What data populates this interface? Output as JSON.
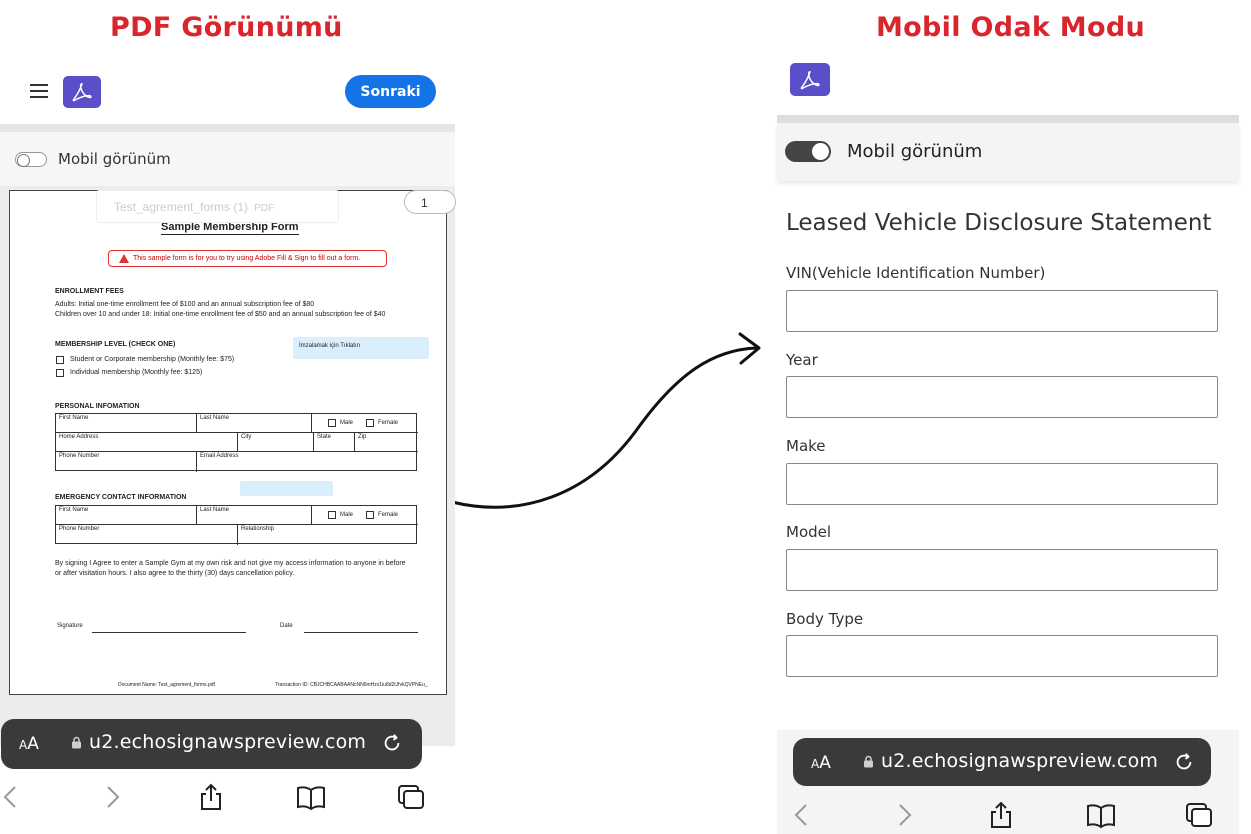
{
  "headings": {
    "left": "PDF Görünümü",
    "right": "Mobil Odak Modu"
  },
  "left_phone": {
    "next_button": "Sonraki",
    "toggle_label": "Mobil görünüm",
    "page_number": "1",
    "doc_name": "Test_agrement_forms (1)",
    "doc_type": "PDF",
    "pdf": {
      "title": "Sample Membership Form",
      "notice": "This sample form is for you to try using Adobe Fill & Sign to fill out a form.",
      "enrollment_title": "ENROLLMENT FEES",
      "enrollment_line1": "Adults: Initial one-time enrollment fee of $100 and an annual subscription fee of $80",
      "enrollment_line2": "Children over 10 and under 18: Initial one-time enrollment fee of $50 and an annual subscription fee of $40",
      "membership_title": "MEMBERSHIP LEVEL (CHECK ONE)",
      "membership_opt1": "Student or Corporate membership (Monthly fee: $75)",
      "membership_opt2": "Individual membership (Monthly fee: $125)",
      "sign_here": "İmzalamak için Tıklatın",
      "personal_title": "PERSONAL INFOMATION",
      "first_name": "First Name",
      "last_name": "Last Name",
      "male": "Male",
      "female": "Female",
      "home_address": "Home Address",
      "city": "City",
      "state": "State",
      "zip": "Zip",
      "phone": "Phone Number",
      "email": "Email Address",
      "emergency_title": "EMERGENCY CONTACT INFORMATION",
      "relationship": "Relationship",
      "agreement_line1": "By signing I Agree to enter a Sample Gym at my own risk and not give my access information to anyone in before",
      "agreement_line2": "or after visitation hours. I also agree to the thirty (30) days cancellation policy.",
      "signature": "Signature",
      "date": "Date",
      "footer_doc": "Document Name: Test_agrement_forms.pdf",
      "footer_tx": "Transaction ID: CBJCHBCAABAANcNN6mHzx1lu8d2tJfvkQVPNEu_"
    },
    "url_bar": {
      "aa": "AA",
      "url": "u2.echosignawspreview.com"
    }
  },
  "right_phone": {
    "toggle_label": "Mobil görünüm",
    "form_title": "Leased Vehicle Disclosure Statement",
    "fields": [
      {
        "label": "VIN(Vehicle Identification Number)",
        "value": ""
      },
      {
        "label": "Year",
        "value": ""
      },
      {
        "label": "Make",
        "value": ""
      },
      {
        "label": "Model",
        "value": ""
      },
      {
        "label": "Body Type",
        "value": ""
      }
    ],
    "url_bar": {
      "aa": "AA",
      "url": "u2.echosignawspreview.com"
    }
  },
  "colors": {
    "heading": "#d8262c",
    "acrobat": "#5b4fc9",
    "primary_button": "#1473e6",
    "url_bar": "#3a3a3c"
  },
  "icons": [
    "menu-icon",
    "acrobat-icon",
    "lock-icon",
    "reload-icon",
    "back-icon",
    "forward-icon",
    "share-icon",
    "bookmarks-icon",
    "tabs-icon",
    "arrow-icon"
  ]
}
